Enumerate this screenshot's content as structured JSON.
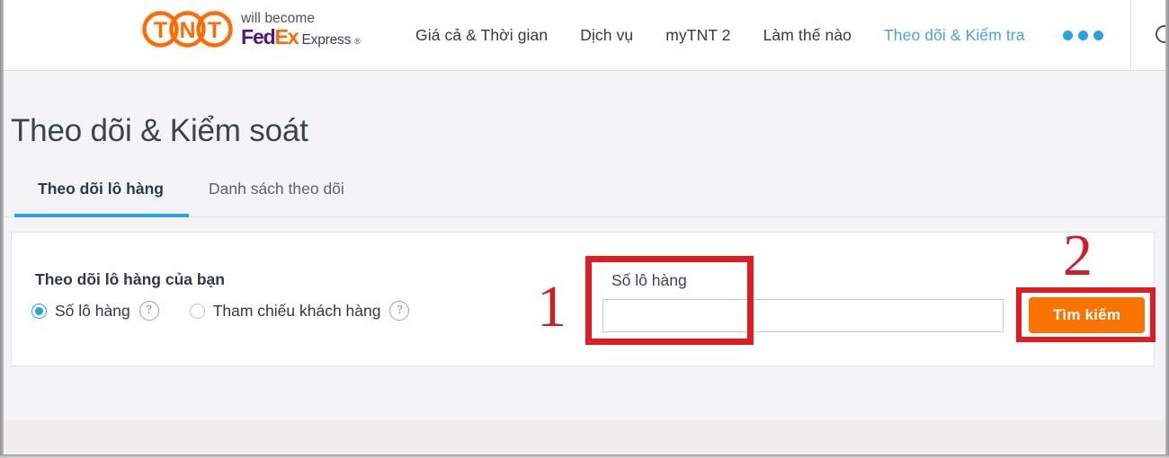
{
  "header": {
    "logo": {
      "tnt_letters": [
        "T",
        "N",
        "T"
      ],
      "will_become": "will become",
      "fedex_fed": "Fed",
      "fedex_ex": "Ex",
      "fedex_express": "Express",
      "fedex_reg": "®"
    },
    "nav_items": [
      {
        "label": "Giá cả & Thời gian",
        "name": "nav-item-pricing-time",
        "active": false
      },
      {
        "label": "Dịch vụ",
        "name": "nav-item-services",
        "active": false
      },
      {
        "label": "myTNT 2",
        "name": "nav-item-mytnt2",
        "active": false
      },
      {
        "label": "Làm thế nào",
        "name": "nav-item-how-to",
        "active": false
      },
      {
        "label": "Theo dõi & Kiểm tra",
        "name": "nav-item-track-trace",
        "active": true
      }
    ],
    "more_menu_label": "•••",
    "search_icon": "search-icon"
  },
  "page": {
    "title": "Theo dõi & Kiểm soát",
    "tabs": [
      {
        "label": "Theo dõi lô hàng",
        "active": true
      },
      {
        "label": "Danh sách theo dõi",
        "active": false
      }
    ]
  },
  "form": {
    "heading": "Theo dõi lô hàng của bạn",
    "radios": [
      {
        "label": "Số lô hàng",
        "selected": true,
        "help": "?"
      },
      {
        "label": "Tham chiếu khách hàng",
        "selected": false,
        "help": "?"
      }
    ],
    "field_label": "Số lô hàng",
    "input_value": "",
    "input_placeholder": "",
    "search_button_label": "Tìm kiếm"
  },
  "annotations": [
    {
      "number": "1",
      "target": "tracking-number-field"
    },
    {
      "number": "2",
      "target": "search-button"
    }
  ],
  "colors": {
    "brand_orange": "#ff6600",
    "brand_purple": "#4d148c",
    "accent_blue": "#29a3e0",
    "button_orange": "#f97300",
    "annotation_red": "#e01b22"
  }
}
